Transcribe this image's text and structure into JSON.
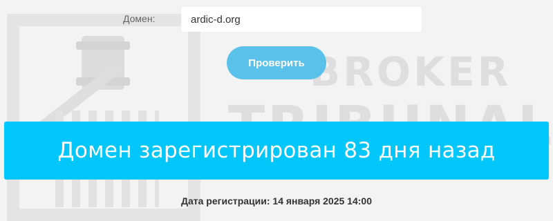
{
  "form": {
    "domain_label": "Домен:",
    "domain_value": "ardic-d.org",
    "check_button_label": "Проверить"
  },
  "result": {
    "message": "Домен зарегистрирован 83 дня назад",
    "registration_label": "Дата регистрации: 14 января 2025 14:00"
  },
  "watermark": {
    "line1": "BROKER",
    "line2": "TRIBUNAL"
  },
  "colors": {
    "banner": "#00c6f9",
    "button": "#5ac1ea",
    "background": "#f3f3f3"
  }
}
